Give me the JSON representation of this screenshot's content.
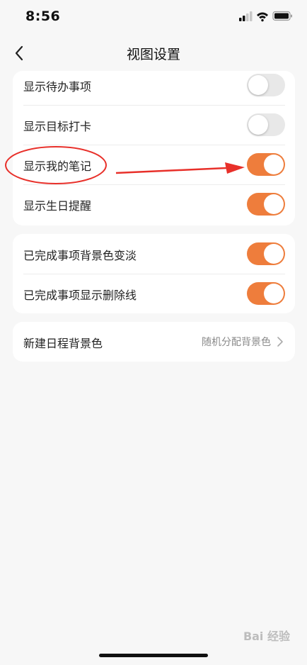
{
  "status_bar": {
    "time": "8:56"
  },
  "nav": {
    "title": "视图设置"
  },
  "group1": [
    {
      "label": "显示待办事项",
      "on": false
    },
    {
      "label": "显示目标打卡",
      "on": false
    },
    {
      "label": "显示我的笔记",
      "on": true
    },
    {
      "label": "显示生日提醒",
      "on": true
    }
  ],
  "group2": [
    {
      "label": "已完成事项背景色变淡",
      "on": true
    },
    {
      "label": "已完成事项显示删除线",
      "on": true
    }
  ],
  "group3": {
    "label": "新建日程背景色",
    "value": "随机分配背景色"
  },
  "watermark": {
    "text": "Bai 经验"
  },
  "colors": {
    "accent": "#ee7d3c",
    "annotation": "#e8302a",
    "background": "#f7f7f7"
  }
}
